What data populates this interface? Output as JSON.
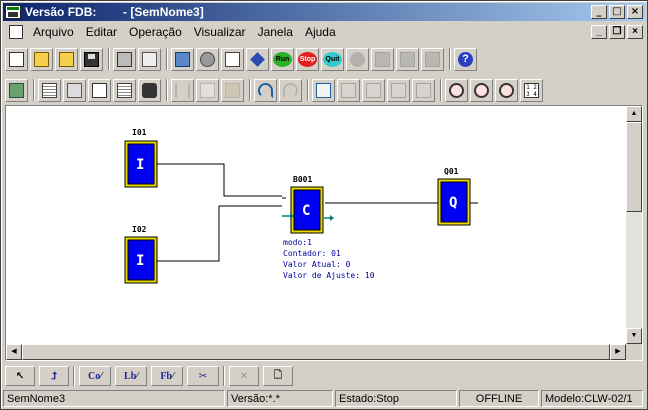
{
  "window": {
    "title": "Versão FDB:        - [SemNome3]",
    "caption_buttons": [
      "_",
      "□",
      "×"
    ]
  },
  "menubar": {
    "items": [
      "Arquivo",
      "Editar",
      "Operação",
      "Visualizar",
      "Janela",
      "Ajuda"
    ],
    "mdi_buttons": [
      "_",
      "❐",
      "×"
    ]
  },
  "toolbar_main": {
    "buttons": [
      {
        "icon": "new-file-icon"
      },
      {
        "icon": "open-folder-icon"
      },
      {
        "icon": "new-folder-icon"
      },
      {
        "icon": "save-disk-icon"
      },
      {
        "icon": "print-icon"
      },
      {
        "icon": "print-preview-icon"
      },
      {
        "icon": "connect-pc-icon"
      },
      {
        "icon": "refresh-gear-icon"
      },
      {
        "icon": "transfer-icon"
      },
      {
        "icon": "tools-icon"
      },
      {
        "label": "Run",
        "icon": "run-icon"
      },
      {
        "label": "Stop",
        "icon": "stop-icon"
      },
      {
        "label": "Quit",
        "icon": "quit-icon"
      },
      {
        "icon": "disabled-circle-icon"
      },
      {
        "icon": "disabled-monitor-icon"
      },
      {
        "icon": "disabled-read-icon"
      },
      {
        "icon": "disabled-write-icon"
      },
      {
        "icon": "help-icon"
      }
    ]
  },
  "toolbar_edit": {
    "buttons": [
      {
        "icon": "block-palette-icon"
      },
      {
        "icon": "connection-tool-icon"
      },
      {
        "icon": "function-block-icon"
      },
      {
        "icon": "comment-icon"
      },
      {
        "icon": "table-icon"
      },
      {
        "icon": "find-binoculars-icon"
      },
      {
        "icon": "cut-icon"
      },
      {
        "icon": "copy-icon"
      },
      {
        "icon": "paste-icon"
      },
      {
        "icon": "undo-icon"
      },
      {
        "icon": "redo-icon"
      },
      {
        "icon": "move-diagonal-icon"
      },
      {
        "icon": "move-up-icon"
      },
      {
        "icon": "move-down-icon"
      },
      {
        "icon": "move-left-icon"
      },
      {
        "icon": "move-right-icon"
      },
      {
        "icon": "zoom-out-icon"
      },
      {
        "icon": "zoom-in-icon"
      },
      {
        "icon": "zoom-fit-icon"
      },
      {
        "label": "1 2 3 4",
        "icon": "grid-numbers-icon"
      }
    ]
  },
  "diagram": {
    "inputs": [
      {
        "id": "I01",
        "letter": "I"
      },
      {
        "id": "I02",
        "letter": "I"
      }
    ],
    "counter": {
      "id": "B001",
      "letter": "C",
      "info": [
        "modo:1",
        "Contador: 01",
        "Valor Atual: 0",
        "Valor de Ajuste: 10"
      ]
    },
    "output": {
      "id": "Q01",
      "letter": "Q"
    }
  },
  "bottom_toolbar": {
    "buttons": [
      {
        "icon": "pointer-icon",
        "label": ""
      },
      {
        "icon": "wire-icon",
        "label": ""
      },
      {
        "icon": "column-icon",
        "label": "Co"
      },
      {
        "icon": "label-icon",
        "label": "Lb"
      },
      {
        "icon": "fb-icon",
        "label": "Fb"
      },
      {
        "icon": "scissors-icon",
        "label": ""
      },
      {
        "icon": "delete-icon",
        "label": ""
      },
      {
        "icon": "page-icon",
        "label": ""
      }
    ]
  },
  "statusbar": {
    "filename": "SemNome3",
    "version": "Versão:*.*",
    "state": "Estado:Stop",
    "connection": "OFFLINE",
    "model": "Modelo:CLW-02/1"
  },
  "colors": {
    "block_fill": "#0000f0",
    "block_border": "#e8d800",
    "info_text": "#0000a0",
    "connector_teal": "#008080"
  }
}
